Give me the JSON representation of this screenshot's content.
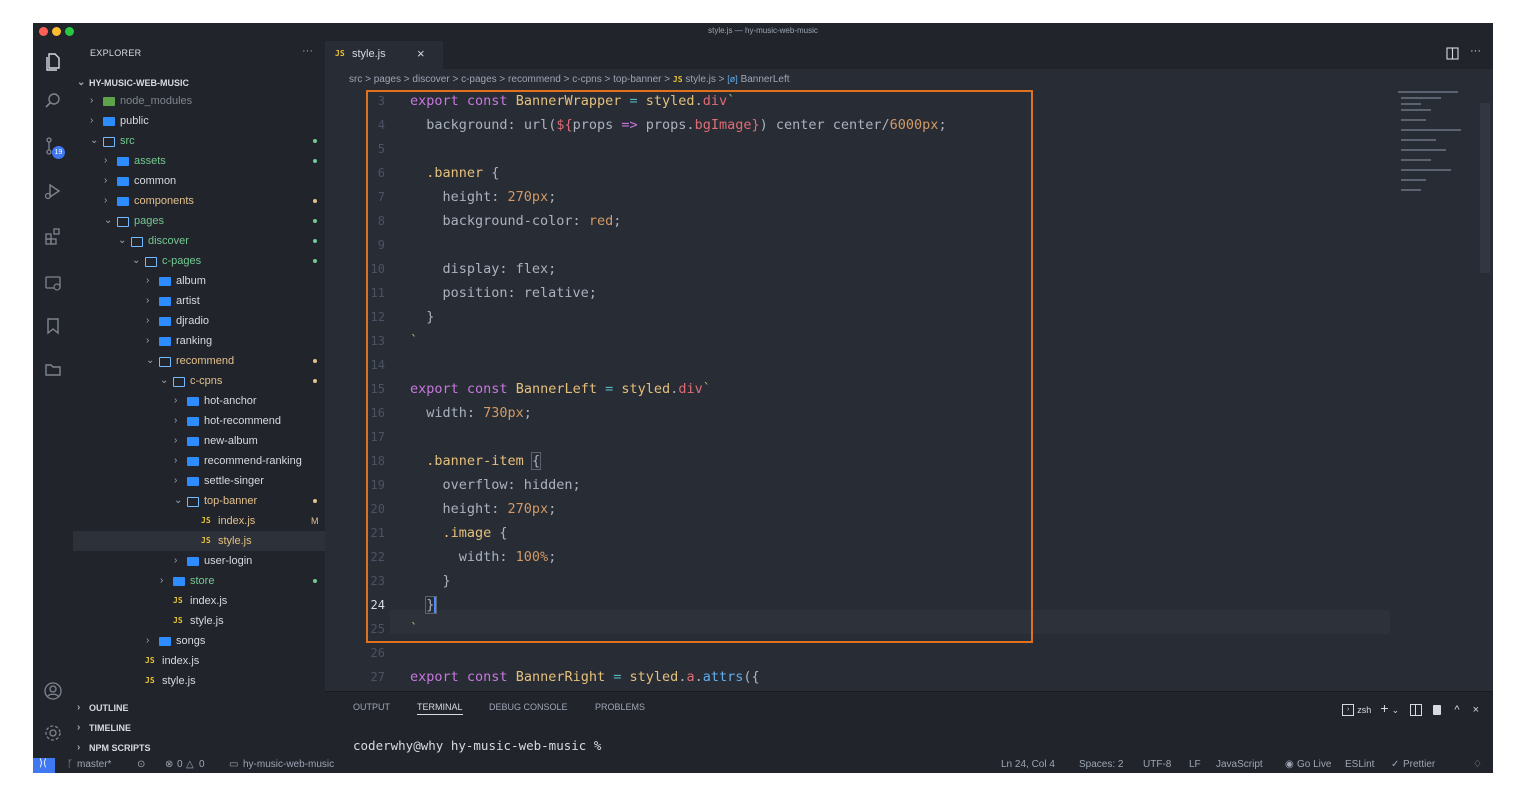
{
  "window": {
    "title": "style.js — hy-music-web-music"
  },
  "explorer": {
    "header": "EXPLORER",
    "more": "···",
    "root": "HY-MUSIC-WEB-MUSIC",
    "items": [
      {
        "label": "node_modules"
      },
      {
        "label": "public"
      },
      {
        "label": "src"
      },
      {
        "label": "assets"
      },
      {
        "label": "common"
      },
      {
        "label": "components"
      },
      {
        "label": "pages"
      },
      {
        "label": "discover"
      },
      {
        "label": "c-pages"
      },
      {
        "label": "album"
      },
      {
        "label": "artist"
      },
      {
        "label": "djradio"
      },
      {
        "label": "ranking"
      },
      {
        "label": "recommend"
      },
      {
        "label": "c-cpns"
      },
      {
        "label": "hot-anchor"
      },
      {
        "label": "hot-recommend"
      },
      {
        "label": "new-album"
      },
      {
        "label": "recommend-ranking"
      },
      {
        "label": "settle-singer"
      },
      {
        "label": "top-banner"
      },
      {
        "label": "index.js",
        "badge": "M"
      },
      {
        "label": "style.js"
      },
      {
        "label": "user-login"
      },
      {
        "label": "store"
      },
      {
        "label": "index.js"
      },
      {
        "label": "style.js"
      },
      {
        "label": "songs"
      },
      {
        "label": "index.js"
      },
      {
        "label": "style.js"
      }
    ],
    "sections": [
      "OUTLINE",
      "TIMELINE",
      "NPM SCRIPTS"
    ]
  },
  "tab": {
    "label": "style.js",
    "js": "JS",
    "close": "×"
  },
  "breadcrumb": {
    "parts": [
      "src",
      "pages",
      "discover",
      "c-pages",
      "recommend",
      "c-cpns",
      "top-banner"
    ],
    "file": "style.js",
    "symbol": "BannerLeft",
    "sep": ">"
  },
  "editor": {
    "line_numbers": [
      "3",
      "4",
      "5",
      "6",
      "7",
      "8",
      "9",
      "10",
      "11",
      "12",
      "13",
      "14",
      "15",
      "16",
      "17",
      "18",
      "19",
      "20",
      "21",
      "22",
      "23",
      "24",
      "25",
      "26",
      "27"
    ],
    "current_line": "24"
  },
  "panel": {
    "tabs": [
      "OUTPUT",
      "TERMINAL",
      "DEBUG CONSOLE",
      "PROBLEMS"
    ],
    "active_tab": "TERMINAL",
    "shell": "zsh",
    "prompt": "coderwhy@why hy-music-web-music %"
  },
  "status": {
    "branch": "master*",
    "errors": "0",
    "warnings": "0",
    "folder": "hy-music-web-music",
    "position": "Ln 24, Col 4",
    "spaces": "Spaces: 2",
    "encoding": "UTF-8",
    "eol": "LF",
    "language": "JavaScript",
    "golive": "Go Live",
    "eslint": "ESLint",
    "prettier": "Prettier"
  },
  "scm_badge": "19",
  "colors": {
    "highlight_box": "#e2711d",
    "accent": "#4078f2",
    "modified": "#e2c08d",
    "untracked": "#73c991"
  }
}
